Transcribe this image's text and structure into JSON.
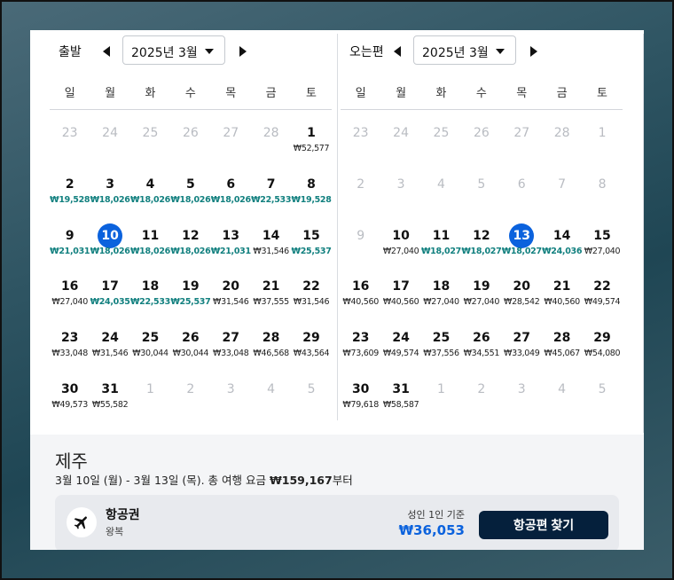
{
  "outbound": {
    "label": "출발",
    "month": "2025년 3월",
    "weekdays": [
      "일",
      "월",
      "화",
      "수",
      "목",
      "금",
      "토"
    ],
    "days": [
      {
        "d": "23",
        "p": "",
        "other": true
      },
      {
        "d": "24",
        "p": "",
        "other": true
      },
      {
        "d": "25",
        "p": "",
        "other": true
      },
      {
        "d": "26",
        "p": "",
        "other": true
      },
      {
        "d": "27",
        "p": "",
        "other": true
      },
      {
        "d": "28",
        "p": "",
        "other": true
      },
      {
        "d": "1",
        "p": "₩52,577"
      },
      {
        "d": "2",
        "p": "₩19,528",
        "low": true
      },
      {
        "d": "3",
        "p": "₩18,026",
        "low": true
      },
      {
        "d": "4",
        "p": "₩18,026",
        "low": true
      },
      {
        "d": "5",
        "p": "₩18,026",
        "low": true
      },
      {
        "d": "6",
        "p": "₩18,026",
        "low": true
      },
      {
        "d": "7",
        "p": "₩22,533",
        "low": true
      },
      {
        "d": "8",
        "p": "₩19,528",
        "low": true
      },
      {
        "d": "9",
        "p": "₩21,031",
        "low": true
      },
      {
        "d": "10",
        "p": "₩18,026",
        "low": true,
        "selected": true
      },
      {
        "d": "11",
        "p": "₩18,026",
        "low": true
      },
      {
        "d": "12",
        "p": "₩18,026",
        "low": true
      },
      {
        "d": "13",
        "p": "₩21,031",
        "low": true
      },
      {
        "d": "14",
        "p": "₩31,546"
      },
      {
        "d": "15",
        "p": "₩25,537",
        "low": true
      },
      {
        "d": "16",
        "p": "₩27,040"
      },
      {
        "d": "17",
        "p": "₩24,035",
        "low": true
      },
      {
        "d": "18",
        "p": "₩22,533",
        "low": true
      },
      {
        "d": "19",
        "p": "₩25,537",
        "low": true
      },
      {
        "d": "20",
        "p": "₩31,546"
      },
      {
        "d": "21",
        "p": "₩37,555"
      },
      {
        "d": "22",
        "p": "₩31,546"
      },
      {
        "d": "23",
        "p": "₩33,048"
      },
      {
        "d": "24",
        "p": "₩31,546"
      },
      {
        "d": "25",
        "p": "₩30,044"
      },
      {
        "d": "26",
        "p": "₩30,044"
      },
      {
        "d": "27",
        "p": "₩33,048"
      },
      {
        "d": "28",
        "p": "₩46,568"
      },
      {
        "d": "29",
        "p": "₩43,564"
      },
      {
        "d": "30",
        "p": "₩49,573"
      },
      {
        "d": "31",
        "p": "₩55,582"
      },
      {
        "d": "1",
        "p": "",
        "other": true
      },
      {
        "d": "2",
        "p": "",
        "other": true
      },
      {
        "d": "3",
        "p": "",
        "other": true
      },
      {
        "d": "4",
        "p": "",
        "other": true
      },
      {
        "d": "5",
        "p": "",
        "other": true
      }
    ]
  },
  "inbound": {
    "label": "오는편",
    "month": "2025년 3월",
    "weekdays": [
      "일",
      "월",
      "화",
      "수",
      "목",
      "금",
      "토"
    ],
    "days": [
      {
        "d": "23",
        "p": "",
        "other": true
      },
      {
        "d": "24",
        "p": "",
        "other": true
      },
      {
        "d": "25",
        "p": "",
        "other": true
      },
      {
        "d": "26",
        "p": "",
        "other": true
      },
      {
        "d": "27",
        "p": "",
        "other": true
      },
      {
        "d": "28",
        "p": "",
        "other": true
      },
      {
        "d": "1",
        "p": "",
        "other": true
      },
      {
        "d": "2",
        "p": "",
        "other": true
      },
      {
        "d": "3",
        "p": "",
        "other": true
      },
      {
        "d": "4",
        "p": "",
        "other": true
      },
      {
        "d": "5",
        "p": "",
        "other": true
      },
      {
        "d": "6",
        "p": "",
        "other": true
      },
      {
        "d": "7",
        "p": "",
        "other": true
      },
      {
        "d": "8",
        "p": "",
        "other": true
      },
      {
        "d": "9",
        "p": "",
        "other": true
      },
      {
        "d": "10",
        "p": "₩27,040"
      },
      {
        "d": "11",
        "p": "₩18,027",
        "low": true
      },
      {
        "d": "12",
        "p": "₩18,027",
        "low": true
      },
      {
        "d": "13",
        "p": "₩18,027",
        "low": true,
        "selected": true
      },
      {
        "d": "14",
        "p": "₩24,036",
        "low": true
      },
      {
        "d": "15",
        "p": "₩27,040"
      },
      {
        "d": "16",
        "p": "₩40,560"
      },
      {
        "d": "17",
        "p": "₩40,560"
      },
      {
        "d": "18",
        "p": "₩27,040"
      },
      {
        "d": "19",
        "p": "₩27,040"
      },
      {
        "d": "20",
        "p": "₩28,542"
      },
      {
        "d": "21",
        "p": "₩40,560"
      },
      {
        "d": "22",
        "p": "₩49,574"
      },
      {
        "d": "23",
        "p": "₩73,609"
      },
      {
        "d": "24",
        "p": "₩49,574"
      },
      {
        "d": "25",
        "p": "₩37,556"
      },
      {
        "d": "26",
        "p": "₩34,551"
      },
      {
        "d": "27",
        "p": "₩33,049"
      },
      {
        "d": "28",
        "p": "₩45,067"
      },
      {
        "d": "29",
        "p": "₩54,080"
      },
      {
        "d": "30",
        "p": "₩79,618"
      },
      {
        "d": "31",
        "p": "₩58,587"
      },
      {
        "d": "1",
        "p": "",
        "other": true
      },
      {
        "d": "2",
        "p": "",
        "other": true
      },
      {
        "d": "3",
        "p": "",
        "other": true
      },
      {
        "d": "4",
        "p": "",
        "other": true
      },
      {
        "d": "5",
        "p": "",
        "other": true
      }
    ]
  },
  "summary": {
    "destination": "제주",
    "dates_text": "3월 10일 (월) - 3월 13일 (목). 총 여행 요금 ",
    "total_price": "₩159,167",
    "total_suffix": "부터"
  },
  "flight_card": {
    "title": "항공권",
    "subtitle": "왕복",
    "basis": "성인 1인 기준",
    "price": "₩36,053",
    "button_label": "항공편 찾기",
    "icon": "airplane-icon"
  },
  "colors": {
    "selected": "#0b62dd",
    "low_price": "#12807f",
    "button_bg": "#05203c"
  }
}
